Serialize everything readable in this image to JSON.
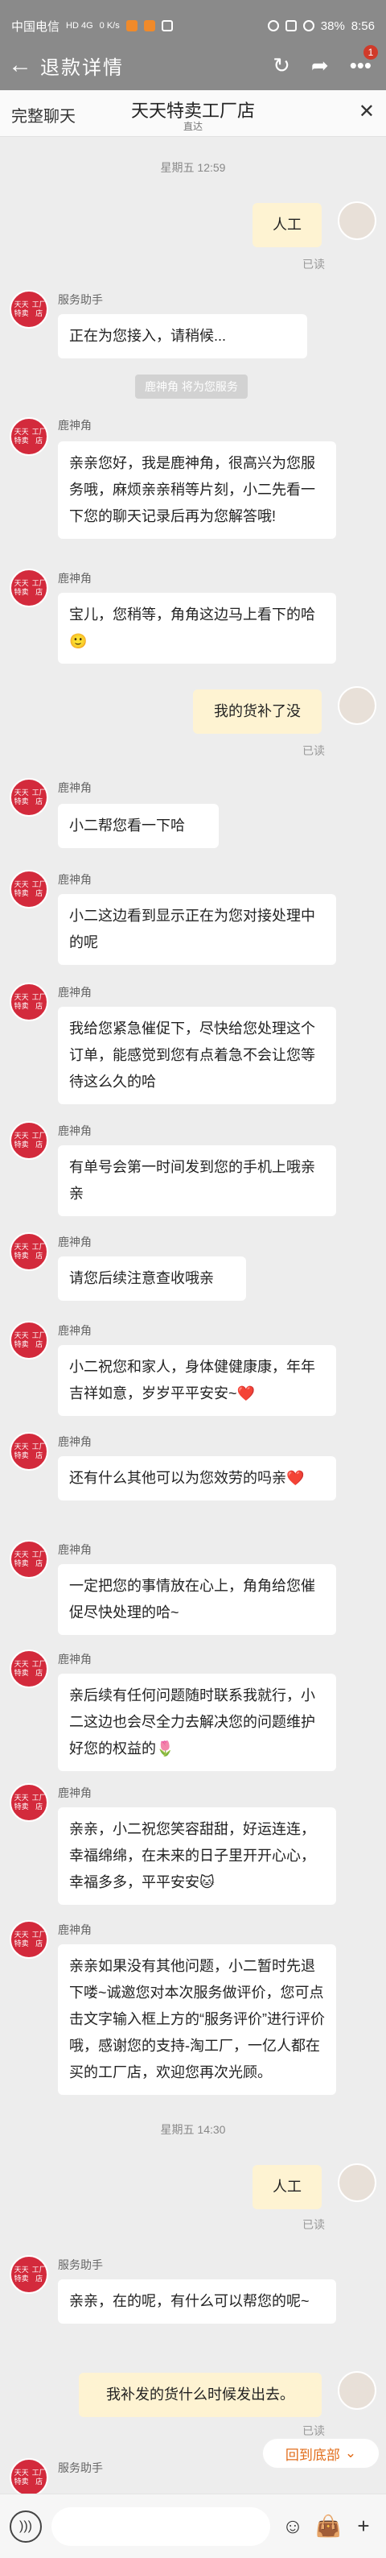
{
  "status_bar": {
    "carrier": "中国电信",
    "network": "HD 4G",
    "speed": "0 K/s",
    "battery": "38%",
    "time": "8:56"
  },
  "titlebar": {
    "back_icon": "arrow-left-icon",
    "title": "退款详情",
    "more_badge": "1"
  },
  "shop": {
    "full_chat_label": "完整聊天",
    "name": "天天特卖工厂店",
    "subtitle": "直达",
    "close_icon": "close-icon"
  },
  "avatars": {
    "shop_text_1": "天天特卖",
    "shop_text_2": "工厂店"
  },
  "messages": {
    "ts1": "星期五 12:59",
    "m1": "人工",
    "m1_read": "已读",
    "m2_sender": "服务助手",
    "m2": "正在为您接入，请稍候...",
    "sys1": "鹿神角 将为您服务",
    "m3_sender": "鹿神角",
    "m3": "亲亲您好，我是鹿神角，很高兴为您服务哦，麻烦亲亲稍等片刻，小二先看一下您的聊天记录后再为您解答哦!",
    "m4_sender": "鹿神角",
    "m4": "宝儿，您稍等，角角这边马上看下的哈🙂",
    "m5": "我的货补了没",
    "m5_read": "已读",
    "m6_sender": "鹿神角",
    "m6": "小二帮您看一下哈",
    "m7_sender": "鹿神角",
    "m7": "小二这边看到显示正在为您对接处理中的呢",
    "m8_sender": "鹿神角",
    "m8": "我给您紧急催促下，尽快给您处理这个订单，能感觉到您有点着急不会让您等待这么久的哈",
    "m9_sender": "鹿神角",
    "m9": "有单号会第一时间发到您的手机上哦亲亲",
    "m10_sender": "鹿神角",
    "m10": "请您后续注意查收哦亲",
    "m11_sender": "鹿神角",
    "m11": "小二祝您和家人，身体健健康康，年年吉祥如意，岁岁平平安安~❤️",
    "m12_sender": "鹿神角",
    "m12": "还有什么其他可以为您效劳的吗亲❤️",
    "m13_sender": "鹿神角",
    "m13": "一定把您的事情放在心上，角角给您催促尽快处理的哈~",
    "m14_sender": "鹿神角",
    "m14": "亲后续有任何问题随时联系我就行，小二这边也会尽全力去解决您的问题维护好您的权益的🌷",
    "m15_sender": "鹿神角",
    "m15": "亲亲，小二祝您笑容甜甜，好运连连，幸福绵绵，在未来的日子里开开心心，幸福多多，平平安安🐱",
    "m16_sender": "鹿神角",
    "m16": "亲亲如果没有其他问题，小二暂时先退下喽~诚邀您对本次服务做评价，您可点击文字输入框上方的“服务评价”进行评价哦，感谢您的支持-淘工厂，一亿人都在买的工厂店，欢迎您再次光顾。",
    "ts2": "星期五 14:30",
    "m17": "人工",
    "m17_read": "已读",
    "m18_sender": "服务助手",
    "m18": "亲亲，在的呢，有什么可以帮您的呢~",
    "m19": "我补发的货什么时候发出去。",
    "m19_read": "已读",
    "m20_sender": "服务助手"
  },
  "bottom": {
    "to_bottom": "回到底部",
    "voice_icon": "voice-icon",
    "emoji_icon": "emoji-icon",
    "bag_icon": "shopping-bag-icon",
    "plus_icon": "plus-icon"
  }
}
